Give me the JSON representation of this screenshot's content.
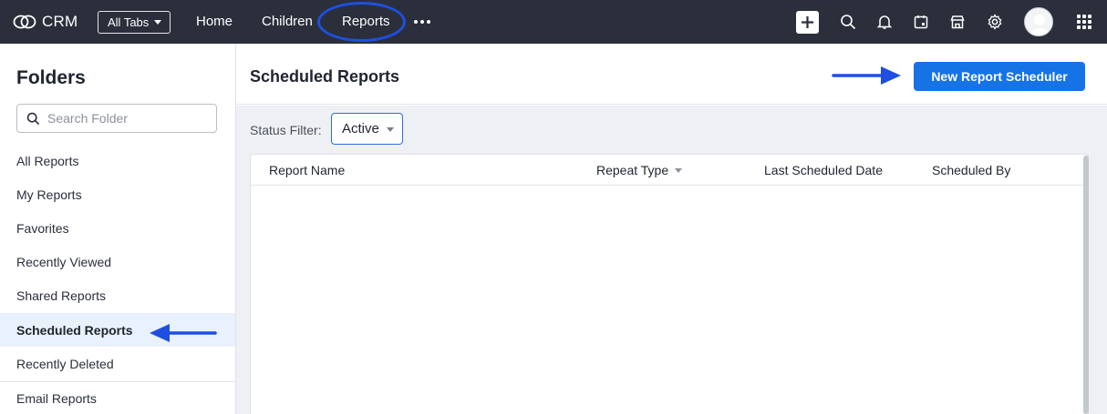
{
  "topbar": {
    "app_name": "CRM",
    "all_tabs_label": "All Tabs",
    "nav": [
      "Home",
      "Children",
      "Reports"
    ],
    "active_nav": "Reports",
    "icons": [
      "plus-icon",
      "search-icon",
      "bell-icon",
      "calendar-icon",
      "store-icon",
      "gear-icon",
      "avatar",
      "apps-grid-icon"
    ]
  },
  "sidebar": {
    "title": "Folders",
    "search_placeholder": "Search Folder",
    "items": [
      {
        "label": "All Reports"
      },
      {
        "label": "My Reports"
      },
      {
        "label": "Favorites"
      },
      {
        "label": "Recently Viewed"
      },
      {
        "label": "Shared Reports"
      },
      {
        "label": "Scheduled Reports",
        "active": true
      },
      {
        "label": "Recently Deleted"
      },
      {
        "label": "Email Reports"
      }
    ]
  },
  "main": {
    "title": "Scheduled Reports",
    "new_button_label": "New Report Scheduler",
    "status_filter_label": "Status Filter:",
    "status_filter_value": "Active",
    "table": {
      "columns": [
        "Report Name",
        "Repeat Type",
        "Last Scheduled Date",
        "Scheduled By"
      ],
      "sorted_column": "Repeat Type",
      "rows": []
    }
  },
  "colors": {
    "topbar_bg": "#2a2f3b",
    "accent_button": "#1673e6",
    "annotation": "#1f4fe0",
    "active_item_bg": "#e9f1fc"
  }
}
